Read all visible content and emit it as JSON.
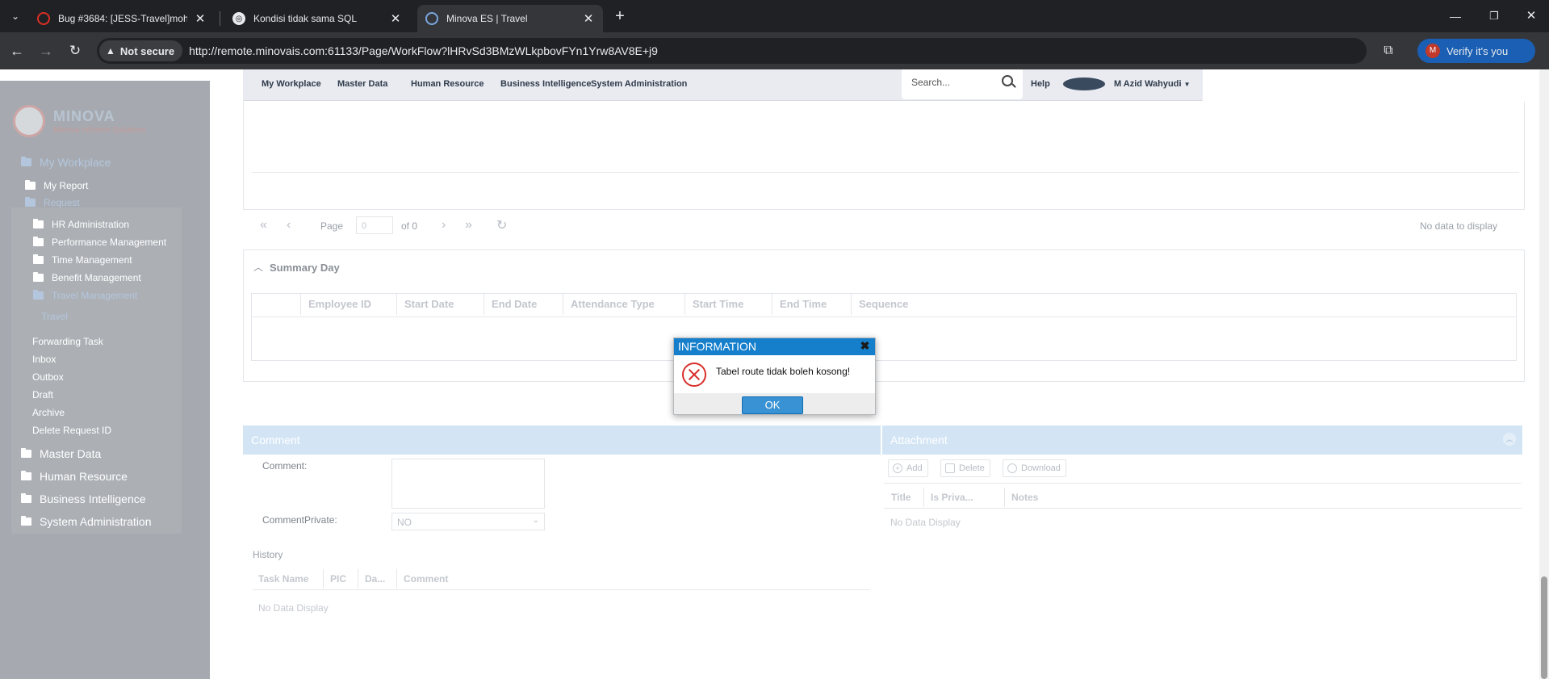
{
  "browser": {
    "tabs": [
      {
        "title": "Bug #3684: [JESS-Travel]mohon",
        "active": false
      },
      {
        "title": "Kondisi tidak sama SQL",
        "active": false
      },
      {
        "title": "Minova ES | Travel",
        "active": true
      }
    ],
    "not_secure": "Not secure",
    "url": "http://remote.minovais.com:61133/Page/WorkFlow?lHRvSd3BMzWLkpbovFYn1Yrw8AV8E+j9",
    "verify_label": "Verify it's you",
    "avatar_initial": "M"
  },
  "sidebar": {
    "my_workplace": "My Workplace",
    "my_report": "My Report",
    "request": "Request",
    "items": [
      "HR Administration",
      "Performance Management",
      "Time Management",
      "Benefit Management"
    ],
    "travel_management": "Travel Management",
    "travel": "Travel",
    "links": [
      "Forwarding Task",
      "Inbox",
      "Outbox",
      "Draft",
      "Archive",
      "Delete Request ID"
    ],
    "modules": [
      "Master Data",
      "Human Resource",
      "Business Intelligence",
      "System Administration"
    ]
  },
  "topnav": {
    "items": [
      "My Workplace",
      "Master Data",
      "Human Resource",
      "Business Intelligence",
      "System Administration"
    ],
    "search_placeholder": "Search...",
    "help": "Help",
    "user": "M Azid Wahyudi"
  },
  "paging": {
    "page_label": "Page",
    "page_value": "0",
    "of_label": "of 0",
    "no_data": "No data to display"
  },
  "summary": {
    "title": "Summary Day",
    "columns": [
      "Employee ID",
      "Start Date",
      "End Date",
      "Attendance Type",
      "Start Time",
      "End Time",
      "Sequence"
    ]
  },
  "comment": {
    "panel_title": "Comment",
    "comment_label": "Comment:",
    "private_label": "CommentPrivate:",
    "private_value": "NO",
    "history_label": "History",
    "history_columns": [
      "Task Name",
      "PIC",
      "Da...",
      "Comment"
    ],
    "history_empty": "No Data Display"
  },
  "attachment": {
    "panel_title": "Attachment",
    "add": "Add",
    "delete": "Delete",
    "download": "Download",
    "columns": [
      "Title",
      "Is Priva...",
      "Notes"
    ],
    "empty": "No Data Display"
  },
  "dialog": {
    "title": "INFORMATION",
    "message": "Tabel route tidak boleh kosong!",
    "ok": "OK"
  },
  "colors": {
    "dialog_header": "#157fcc",
    "panel_header": "#d3e5f5",
    "sidebar_bg": "#a6aab0",
    "error_red": "#d9302c"
  }
}
